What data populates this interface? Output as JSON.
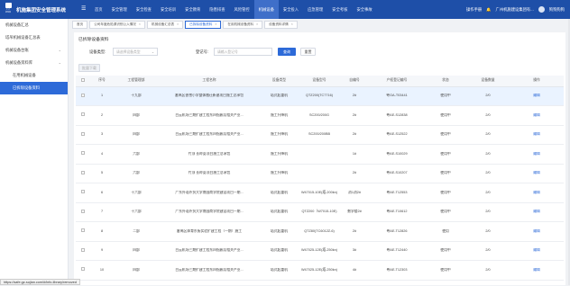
{
  "app": {
    "logo_line1": "户 户",
    "logo_line2": "机电科",
    "title": "机施集团安全管理系统"
  },
  "nav": {
    "items": [
      "首页",
      "安全管理",
      "安全检查",
      "安全培训",
      "安全教育",
      "隐患排查",
      "风险管控",
      "机械设备",
      "安全投入",
      "应急管理",
      "安全考核",
      "安全事故"
    ],
    "active_index": 7
  },
  "header": {
    "manual": "操作手册",
    "org": "广州机施建设集团有...",
    "user": "狗狗狗狗"
  },
  "sidebar": {
    "items": [
      {
        "label": "机械设备汇总",
        "level": 1,
        "expandable": false
      },
      {
        "label": "塔吊机械设备汇总表",
        "level": 1,
        "expandable": false
      },
      {
        "label": "机械设备台账",
        "level": 1,
        "expandable": true
      },
      {
        "label": "机械设备资料库",
        "level": 1,
        "expandable": true
      },
      {
        "label": "在用机械设备",
        "level": 2,
        "expandable": false
      },
      {
        "label": "已拆除设备资料",
        "level": 2,
        "expandable": false
      }
    ],
    "active_index": 5
  },
  "tabs": [
    {
      "label": "首页",
      "closable": false
    },
    {
      "label": "公司年度危险源识别公入情况",
      "closable": true
    },
    {
      "label": "机械设备汇总表",
      "closable": true
    },
    {
      "label": "已拆除设备资料",
      "closable": true
    },
    {
      "label": "在用机械设备资料",
      "closable": true
    },
    {
      "label": "设备资料详情",
      "closable": true
    }
  ],
  "tabs_active_index": 3,
  "page": {
    "title": "已拆除设备资料"
  },
  "filter": {
    "type_label": "设备类型:",
    "type_placeholder": "请选择设备类型",
    "reg_label": "登记号:",
    "reg_placeholder": "请输入登记号",
    "query_button": "查询",
    "reset_button": "重置",
    "export_button": "批量下载"
  },
  "table": {
    "columns": [
      "",
      "序号",
      "工程管理部",
      "工程名称",
      "设备类型",
      "设备型号",
      "自编号",
      "产权登记编号",
      "状态",
      "设备数量",
      "操作"
    ],
    "rows": [
      {
        "no": "1",
        "dept": "十九部",
        "project": "番禺区香雪小学整体搬迁新建项目施工总承包",
        "type": "塔式起重机",
        "model": "QTZ200(TC7716)",
        "code": "2#",
        "reg": "粤GA-T03441",
        "status": "使用中",
        "qty": "2/0",
        "action": "编辑"
      },
      {
        "no": "2",
        "dept": "四部",
        "project": "白云机场三期扩建工程东四指廊及相关产业...",
        "type": "施工升降机",
        "model": "SC200/200G",
        "code": "2#",
        "reg": "粤AE-S12838",
        "status": "使用中",
        "qty": "2/0",
        "action": "编辑"
      },
      {
        "no": "3",
        "dept": "四部",
        "project": "白云机场三期扩建工程东四指廊及相关产业...",
        "type": "施工升降机",
        "model": "SC200/200BB",
        "code": "2#",
        "reg": "粤AE-S12522",
        "status": "使用中",
        "qty": "2/0",
        "action": "编辑"
      },
      {
        "no": "4",
        "dept": "六部",
        "project": "竹顶 长岭夏项目施工总承包",
        "type": "施工升降机",
        "model": "",
        "code": "1#",
        "reg": "粤AE-S10029",
        "status": "使用中",
        "qty": "2/0",
        "action": "编辑"
      },
      {
        "no": "5",
        "dept": "六部",
        "project": "竹顶 长岭夏项目施工总承包",
        "type": "施工升降机",
        "model": "",
        "code": "2#",
        "reg": "粤AE-S10207",
        "status": "使用中",
        "qty": "2/0",
        "action": "编辑"
      },
      {
        "no": "6",
        "dept": "十六部",
        "project": "广东外语外贸大学南国商学院建设项目一期...",
        "type": "塔式起重机",
        "model": "W47015-10E(塔-200kn)",
        "code": "消1消2#",
        "reg": "粤AE-T12553",
        "status": "使用中",
        "qty": "2/0",
        "action": "编辑"
      },
      {
        "no": "7",
        "dept": "十六部",
        "project": "广东外语外贸大学南国商学院建设项目一期...",
        "type": "塔式起重机",
        "model": "QTZ200（W7015-10E)",
        "code": "数学楼2#",
        "reg": "粤AE-T10612",
        "status": "使用中",
        "qty": "2/0",
        "action": "编辑"
      },
      {
        "no": "8",
        "dept": "二部",
        "project": "番禺区体育东街实验扩建工程（一期）施工",
        "type": "塔式起重机",
        "model": "QTZ80(TC6012Z-6)",
        "code": "2#",
        "reg": "粤AE-T12826",
        "status": "使用",
        "qty": "2/0",
        "action": "编辑"
      },
      {
        "no": "9",
        "dept": "四部",
        "project": "白云机场三期扩建工程东四指廊及相关产业...",
        "type": "塔式起重机",
        "model": "W47025-12E(塔-250kn)",
        "code": "3#",
        "reg": "粤AE-T12440",
        "status": "使用中",
        "qty": "2/0",
        "action": "编辑"
      },
      {
        "no": "10",
        "dept": "四部",
        "project": "白云机场三期扩建工程东四指廊及相关产业...",
        "type": "塔式起重机",
        "model": "W47025-12E(塔-250kn)",
        "code": "4#",
        "reg": "粤AE-T12303",
        "status": "使用中",
        "qty": "2/0",
        "action": "编辑"
      }
    ],
    "highlight_row": 0
  },
  "statusbar": {
    "url": "https://safe.gz-sujian.com/#/info-library/removed"
  },
  "colors": {
    "topbar": "#1e4fa8",
    "accent": "#2d6ad8",
    "highlight": "#eaf3ff"
  }
}
